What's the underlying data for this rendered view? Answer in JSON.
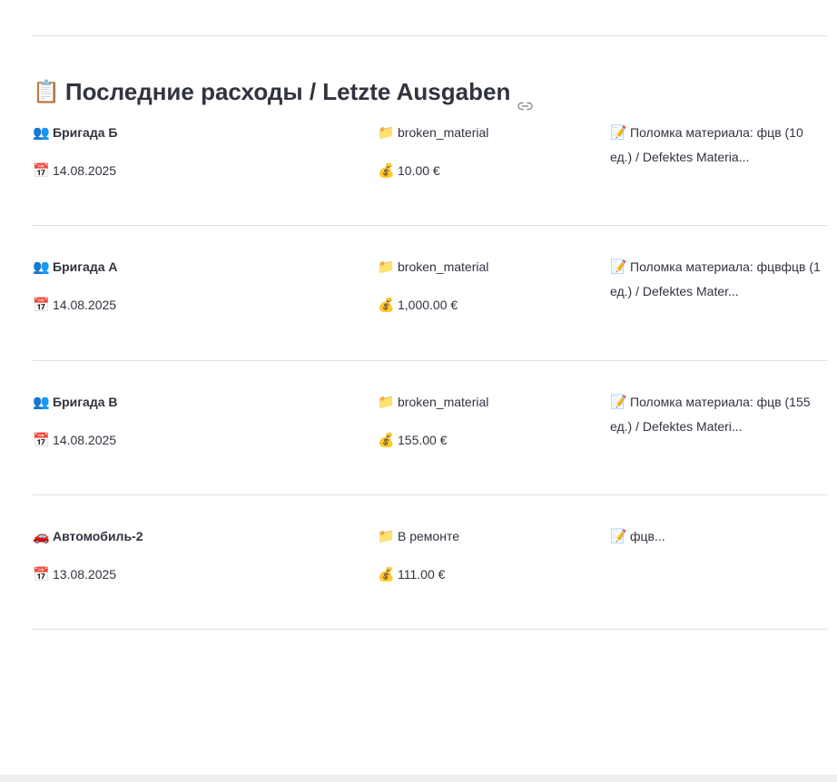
{
  "section": {
    "emoji": "📋",
    "title": "Последние расходы / Letzte Ausgaben",
    "link_icon": "link-icon"
  },
  "icons": {
    "team": "👥",
    "car": "🚗",
    "date": "📅",
    "category": "📁",
    "money": "💰",
    "note": "📝"
  },
  "expenses": [
    {
      "who_icon": "👥",
      "who": "Бригада Б",
      "date": "14.08.2025",
      "category": "broken_material",
      "amount": "10.00 €",
      "description": "Поломка материала: фцв (10 ед.) / Defektes Materia..."
    },
    {
      "who_icon": "👥",
      "who": "Бригада А",
      "date": "14.08.2025",
      "category": "broken_material",
      "amount": "1,000.00 €",
      "description": "Поломка материала: фцвфцв (1 ед.) / Defektes Mater..."
    },
    {
      "who_icon": "👥",
      "who": "Бригада В",
      "date": "14.08.2025",
      "category": "broken_material",
      "amount": "155.00 €",
      "description": "Поломка материала: фцв (155 ед.) / Defektes Materi..."
    },
    {
      "who_icon": "🚗",
      "who": "Автомобиль-2",
      "date": "13.08.2025",
      "category": "В ремонте",
      "amount": "111.00 €",
      "description": "фцв..."
    }
  ]
}
